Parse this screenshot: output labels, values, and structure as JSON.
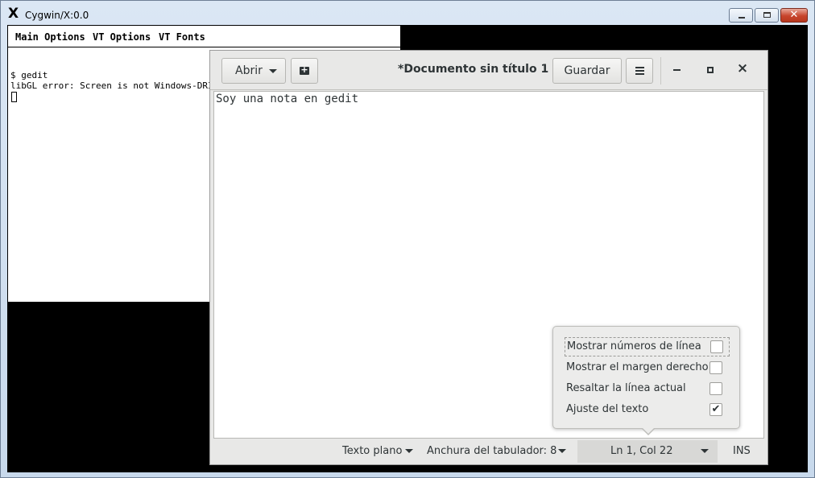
{
  "xwindow": {
    "title": "Cygwin/X:0.0",
    "logo": "X",
    "buttons": {
      "minimize": "minimize-icon",
      "maximize": "maximize-icon",
      "close": "✕"
    }
  },
  "xterm": {
    "menu": [
      "Main Options",
      "VT Options",
      "VT Fonts"
    ],
    "lines": [
      "$ gedit",
      "libGL error: Screen is not Windows-DRI cap"
    ]
  },
  "gedit": {
    "open_label": "Abrir",
    "title": "*Documento sin título 1",
    "save_label": "Guardar",
    "close_glyph": "×",
    "text": "Soy una nota en gedit",
    "status": {
      "language": "Texto plano",
      "tab_width": "Anchura del tabulador: 8",
      "position": "Ln 1, Col 22",
      "mode": "INS"
    },
    "popover": {
      "options": [
        {
          "label": "Mostrar números de línea",
          "checked": false
        },
        {
          "label": "Mostrar el margen derecho",
          "checked": false
        },
        {
          "label": "Resaltar la línea actual",
          "checked": false
        },
        {
          "label": "Ajuste del texto",
          "checked": true
        }
      ]
    }
  },
  "colors": {
    "accent_close": "#c7442c",
    "gedit_bg": "#e8e8e7",
    "text": "#2e3436"
  }
}
